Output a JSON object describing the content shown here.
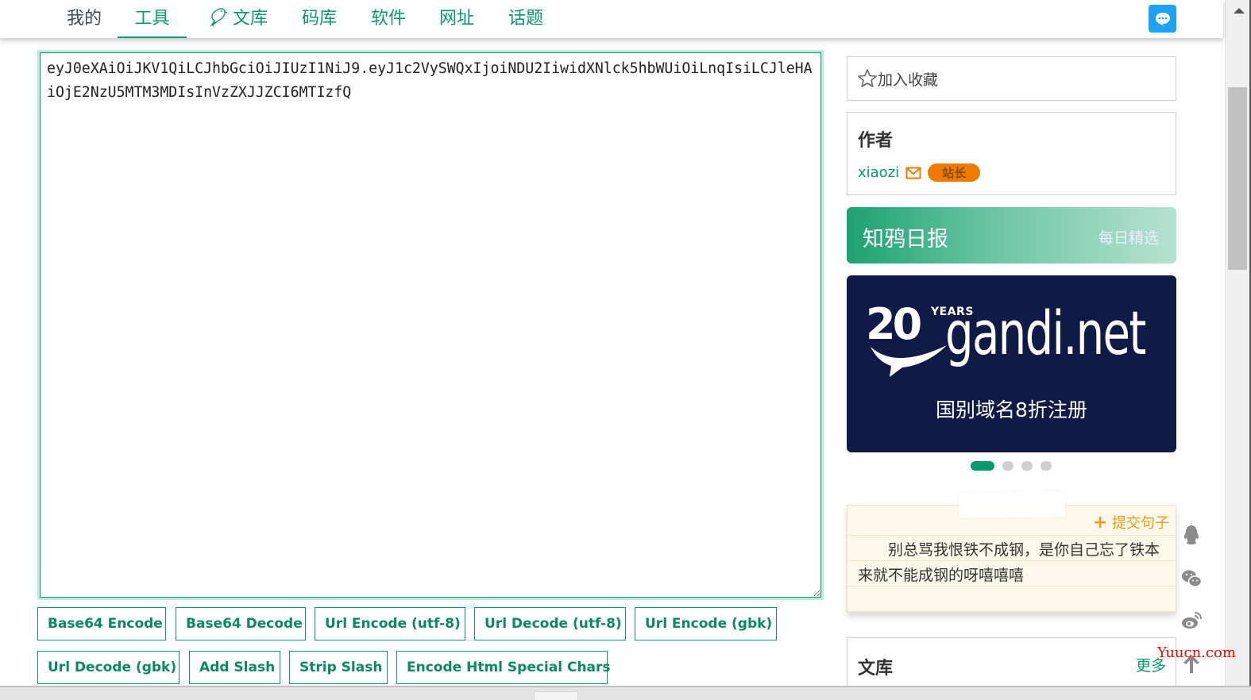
{
  "nav": {
    "items": [
      {
        "label": "我的"
      },
      {
        "label": "工具"
      },
      {
        "label": "文库",
        "icon": "bird-icon"
      },
      {
        "label": "码库"
      },
      {
        "label": "软件"
      },
      {
        "label": "网址"
      },
      {
        "label": "话题"
      }
    ],
    "active_index": 1,
    "chat_icon": "chat-bubble-icon"
  },
  "editor": {
    "value": "eyJ0eXAiOiJKV1QiLCJhbGciOiJIUzI1NiJ9.eyJ1c2VySWQxIjoiNDU2IiwidXNlck5hbWUiOiLnqIsiLCJleHAiOjE2NzU5MTM3MDIsInVzZXJJZCI6MTIzfQ"
  },
  "buttons": [
    "Base64 Encode",
    "Base64 Decode",
    "Url Encode (utf-8)",
    "Url Decode (utf-8)",
    "Url Encode (gbk)",
    "Url Decode (gbk)",
    "Add Slash",
    "Strip Slash",
    "Encode Html Special Chars"
  ],
  "sidebar": {
    "favorite": {
      "label": "加入收藏",
      "icon": "star-icon"
    },
    "author": {
      "title": "作者",
      "name": "xiaozi",
      "mail_icon": "mail-icon",
      "badge": "站长"
    },
    "daily": {
      "title": "知鸦日报",
      "subtitle": "每日精选"
    },
    "banner": {
      "years_number": "20",
      "years_label": "YEARS",
      "brand": "gandi.net",
      "promo": "国别域名8折注册",
      "slides_total": 4,
      "active_slide": 1
    },
    "quote": {
      "submit_label": "提交句子",
      "text": "别总骂我恨铁不成钢，是你自己忘了铁本来就不能成钢的呀嘻嘻嘻"
    },
    "library": {
      "title": "文库",
      "more": "更多"
    }
  },
  "float_icons": [
    "qq-icon",
    "wechat-icon",
    "weibo-icon",
    "back-to-top-icon"
  ],
  "watermark": "Yuucn.com",
  "colors": {
    "accent": "#079a6a",
    "badge": "#ee7a00",
    "chat": "#1da1f2",
    "banner_bg": "#0f1a47",
    "quote_bg": "#fdf9ea",
    "submit": "#ef9a1a"
  }
}
